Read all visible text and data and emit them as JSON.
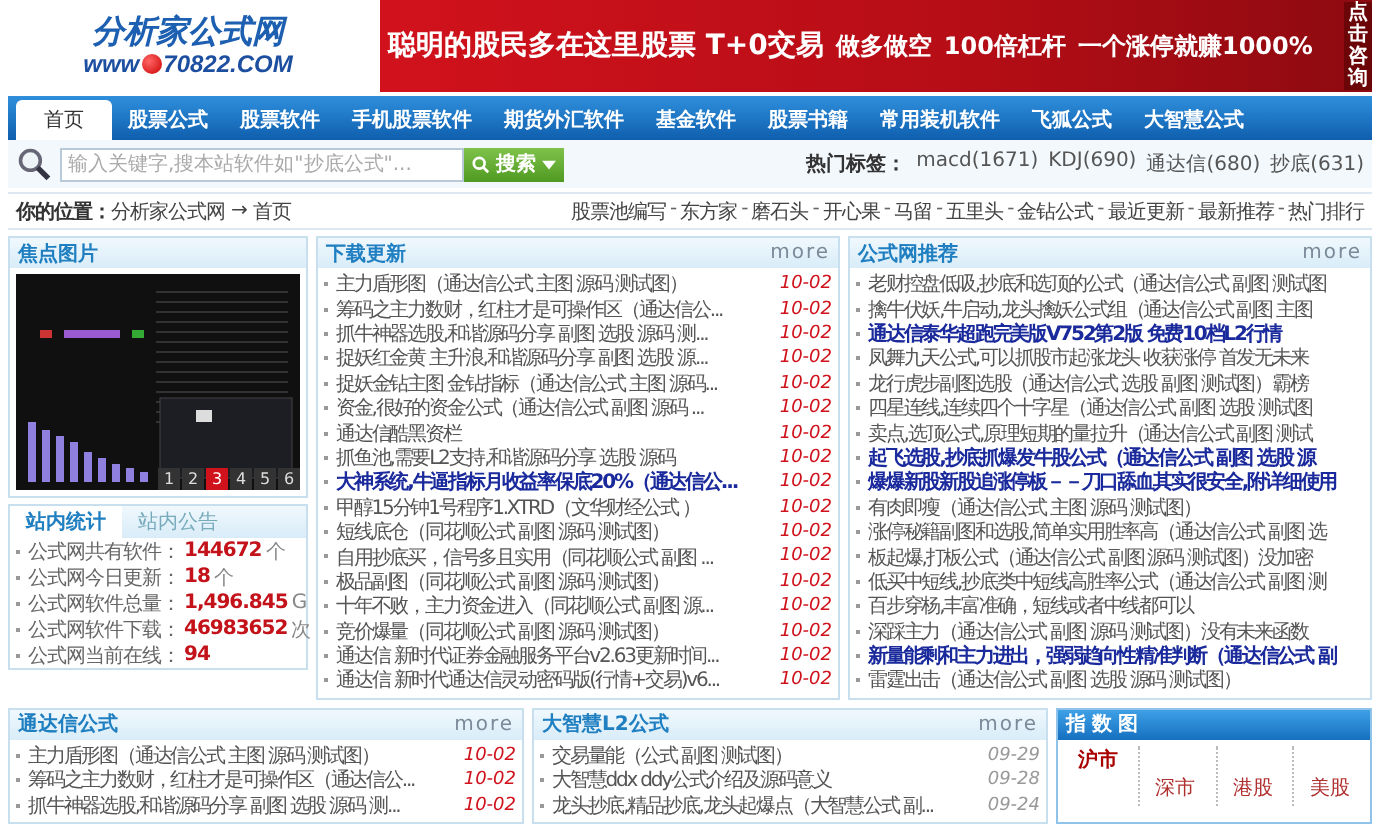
{
  "header": {
    "logo": {
      "title": "分析家公式网",
      "url_prefix": "www",
      "url_rest": "70822.COM"
    },
    "banner": {
      "headline": "聪明的股民多在这里股票 T+0交易",
      "slogans": [
        "做多做空",
        "100倍杠杆",
        "一个涨停就赚1000%"
      ],
      "side_label": "点击咨询"
    }
  },
  "nav": [
    {
      "label": "首页",
      "selected": true
    },
    {
      "label": "股票公式",
      "selected": false
    },
    {
      "label": "股票软件",
      "selected": false
    },
    {
      "label": "手机股票软件",
      "selected": false
    },
    {
      "label": "期货外汇软件",
      "selected": false
    },
    {
      "label": "基金软件",
      "selected": false
    },
    {
      "label": "股票书籍",
      "selected": false
    },
    {
      "label": "常用装机软件",
      "selected": false
    },
    {
      "label": "飞狐公式",
      "selected": false
    },
    {
      "label": "大智慧公式",
      "selected": false
    }
  ],
  "search": {
    "placeholder": "输入关键字,搜本站软件如\"抄底公式\"...",
    "button": "搜索"
  },
  "hot_tags": {
    "label": "热门标签：",
    "tags": [
      "macd(1671)",
      "KDJ(690)",
      "通达信(680)",
      "抄底(631)"
    ]
  },
  "breadcrumb": {
    "label": "你的位置：",
    "path": [
      "分析家公式网",
      "首页"
    ],
    "arrow": "→"
  },
  "quick_links": {
    "separator": "-",
    "links": [
      "股票池编写",
      "东方家",
      "磨石头",
      "开心果",
      "马留",
      "五里头",
      "金钻公式",
      "最近更新",
      "最新推荐",
      "热门排行"
    ]
  },
  "focus": {
    "title": "焦点图片",
    "pager": [
      {
        "label": "1",
        "selected": false
      },
      {
        "label": "2",
        "selected": false
      },
      {
        "label": "3",
        "selected": true
      },
      {
        "label": "4",
        "selected": false
      },
      {
        "label": "5",
        "selected": false
      },
      {
        "label": "6",
        "selected": false
      }
    ]
  },
  "stats": {
    "tabs": [
      {
        "label": "站内统计",
        "selected": true
      },
      {
        "label": "站内公告",
        "selected": false
      }
    ],
    "rows": [
      {
        "label": "公式网共有软件：",
        "value": "144672",
        "unit": "个"
      },
      {
        "label": "公式网今日更新：",
        "value": "18",
        "unit": "个"
      },
      {
        "label": "公式网软件总量：",
        "value": "1,496.845",
        "unit": "G"
      },
      {
        "label": "公式网软件下载：",
        "value": "46983652",
        "unit": "次"
      },
      {
        "label": "公式网当前在线：",
        "value": "94"
      }
    ]
  },
  "downloads": {
    "title": "下载更新",
    "more": "more",
    "items": [
      {
        "title": "主力盾形图（通达信公式 主图 源码 测试图）",
        "date": "10-02",
        "highlighted": false
      },
      {
        "title": "筹码之主力数财，红柱才是可操作区（通达信公...",
        "date": "10-02",
        "highlighted": false
      },
      {
        "title": "抓牛神器选股,和谐源码分享 副图 选股 源码 测...",
        "date": "10-02",
        "highlighted": false
      },
      {
        "title": "捉妖红金黄 主升浪,和谐源码分享 副图 选股 源...",
        "date": "10-02",
        "highlighted": false
      },
      {
        "title": "捉妖金钻主图 金钻指标（通达信公式 主图 源码...",
        "date": "10-02",
        "highlighted": false
      },
      {
        "title": "资金,很好的资金公式（通达信公式 副图 源码 ...",
        "date": "10-02",
        "highlighted": false
      },
      {
        "title": "通达信酷黑资栏",
        "date": "10-02",
        "highlighted": false
      },
      {
        "title": "抓鱼池,需要L2支持,和谐源码分享 选股 源码",
        "date": "10-02",
        "highlighted": false
      },
      {
        "title": "大神系统,牛逼指标月收益率保底20%（通达信公...",
        "date": "10-02",
        "highlighted": true
      },
      {
        "title": "甲醇15分钟1号程序1.XTRD（文华财经公式 ）",
        "date": "10-02",
        "highlighted": false
      },
      {
        "title": "短线底仓（同花顺公式 副图 源码 测试图）",
        "date": "10-02",
        "highlighted": false
      },
      {
        "title": "自用抄底买，信号多且实用（同花顺公式 副图 ...",
        "date": "10-02",
        "highlighted": false
      },
      {
        "title": "极品副图（同花顺公式 副图 源码 测试图）",
        "date": "10-02",
        "highlighted": false
      },
      {
        "title": "十年不败，主力资金进入（同花顺公式 副图 源...",
        "date": "10-02",
        "highlighted": false
      },
      {
        "title": "竞价爆量（同花顺公式 副图 源码 测试图）",
        "date": "10-02",
        "highlighted": false
      },
      {
        "title": "通达信 新时代证券金融服务平台v2.63更新时间...",
        "date": "10-02",
        "highlighted": false
      },
      {
        "title": "通达信 新时代通达信灵动密码版(行情+交易)v6...",
        "date": "10-02",
        "highlighted": false
      }
    ]
  },
  "recommend": {
    "title": "公式网推荐",
    "more": "more",
    "items": [
      {
        "title": "老财控盘低吸,抄底和选顶的公式（通达信公式 副图 测试图",
        "highlighted": false
      },
      {
        "title": "擒牛伏妖,牛启动,龙头擒妖公式组（通达信公式 副图 主图",
        "highlighted": false
      },
      {
        "title": "通达信泰华超跑完美版V752第2版 免费10档L2行情",
        "highlighted": true
      },
      {
        "title": "凤舞九天公式,可以抓股市起涨龙头 收获涨停 首发无未来",
        "highlighted": false
      },
      {
        "title": "龙行虎步副图选股（通达信公式 选股 副图 测试图）霸榜",
        "highlighted": false
      },
      {
        "title": "四星连线,连续四个十字星（通达信公式 副图 选股 测试图",
        "highlighted": false
      },
      {
        "title": "卖点,选顶公式,原理短期的量拉升（通达信公式 副图 测试",
        "highlighted": false
      },
      {
        "title": "起飞选股,抄底抓爆发牛股公式（通达信公式 副图 选股 源",
        "highlighted": true
      },
      {
        "title": "爆爆新股新股追涨停板－－刀口舔血其实很安全,附详细使用",
        "highlighted": true
      },
      {
        "title": "有肉即瘦（通达信公式 主图 源码 测试图）",
        "highlighted": false
      },
      {
        "title": "涨停秘籍副图和选股,简单实用胜率高（通达信公式 副图 选",
        "highlighted": false
      },
      {
        "title": "板起爆,打板公式（通达信公式 副图 源码 测试图）没加密",
        "highlighted": false
      },
      {
        "title": "低买中短线,抄底类中短线高胜率公式（通达信公式 副图 测",
        "highlighted": false
      },
      {
        "title": "百步穿杨,丰富准确，短线或者中线都可以",
        "highlighted": false
      },
      {
        "title": "深踩主力（通达信公式 副图 源码 测试图）没有未来函数",
        "highlighted": false
      },
      {
        "title": "新量能剩和主力进出，强弱趋向性精准判断（通达信公式 副",
        "highlighted": true
      },
      {
        "title": "雷霆出击（通达信公式 副图 选股 源码 测试图）",
        "highlighted": false
      }
    ]
  },
  "tdx": {
    "title": "通达信公式",
    "more": "more",
    "items": [
      {
        "title": "主力盾形图（通达信公式 主图 源码 测试图）",
        "date": "10-02",
        "highlighted": false
      },
      {
        "title": "筹码之主力数财，红柱才是可操作区（通达信公...",
        "date": "10-02",
        "highlighted": false
      },
      {
        "title": "抓牛神器选股,和谐源码分享 副图 选股 源码 测...",
        "date": "10-02",
        "highlighted": false
      }
    ]
  },
  "dzh": {
    "title": "大智慧L2公式",
    "more": "more",
    "items": [
      {
        "title": "交易量能（公式 副图 测试图）",
        "date": "09-29",
        "highlighted": false
      },
      {
        "title": "大智慧ddx ddy公式介绍及源码意义",
        "date": "09-28",
        "highlighted": false
      },
      {
        "title": "龙头抄底,精品抄底,龙头起爆点（大智慧公式 副...",
        "date": "09-24",
        "highlighted": false
      }
    ]
  },
  "index": {
    "title": "指数图",
    "tabs": [
      {
        "label": "沪市",
        "selected": true
      },
      {
        "label": "深市",
        "selected": false
      },
      {
        "label": "港股",
        "selected": false
      },
      {
        "label": "美股",
        "selected": false
      }
    ]
  }
}
